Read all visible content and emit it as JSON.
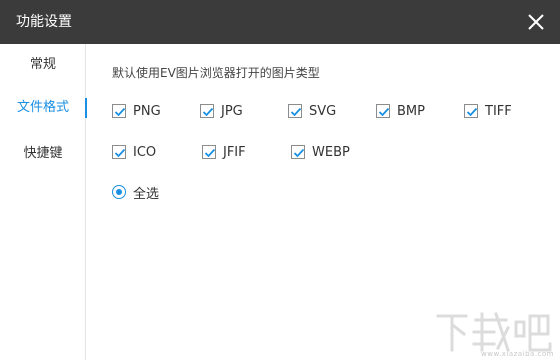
{
  "window": {
    "title": "功能设置",
    "close_icon": "close-icon"
  },
  "sidebar": {
    "items": [
      {
        "label": "常规",
        "active": false
      },
      {
        "label": "文件格式",
        "active": true
      },
      {
        "label": "快捷键",
        "active": false
      }
    ]
  },
  "main": {
    "description": "默认使用EV图片浏览器打开的图片类型",
    "formats": [
      {
        "label": "PNG",
        "checked": true
      },
      {
        "label": "JPG",
        "checked": true
      },
      {
        "label": "SVG",
        "checked": true
      },
      {
        "label": "BMP",
        "checked": true
      },
      {
        "label": "TIFF",
        "checked": true
      },
      {
        "label": "ICO",
        "checked": true
      },
      {
        "label": "JFIF",
        "checked": true
      },
      {
        "label": "WEBP",
        "checked": true
      }
    ],
    "select_all": {
      "label": "全选",
      "selected": true
    }
  },
  "watermark": {
    "logo": "下载吧",
    "url": "www.xiazaiba.com"
  },
  "colors": {
    "titlebar": "#3b3b3b",
    "accent": "#1a8fe3"
  }
}
